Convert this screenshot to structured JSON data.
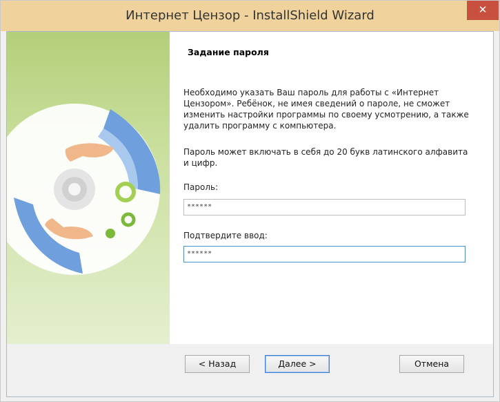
{
  "window": {
    "title": "Интернет Цензор - InstallShield Wizard",
    "close_label": "✕"
  },
  "page": {
    "heading": "Задание пароля",
    "paragraph1": "Необходимо указать Ваш пароль для работы с «Интернет Цензором». Ребёнок, не имея сведений о пароле, не сможет изменить настройки программы по своему усмотрению, а также удалить программу с компьютера.",
    "paragraph2": "Пароль может включать в себя до 20 букв латинского алфавита и цифр.",
    "password_label": "Пароль:",
    "password_value": "******",
    "confirm_label": "Подтвердите ввод:",
    "confirm_value": "******"
  },
  "buttons": {
    "back": "< Назад",
    "next": "Далее >",
    "cancel": "Отмена"
  },
  "icons": {
    "banner": "cd-disc-hands-icon"
  },
  "colors": {
    "titlebar": "#f0d29c",
    "close": "#c7503e",
    "banner": "#b4cf7a",
    "focus_border": "#4c8fd9"
  }
}
